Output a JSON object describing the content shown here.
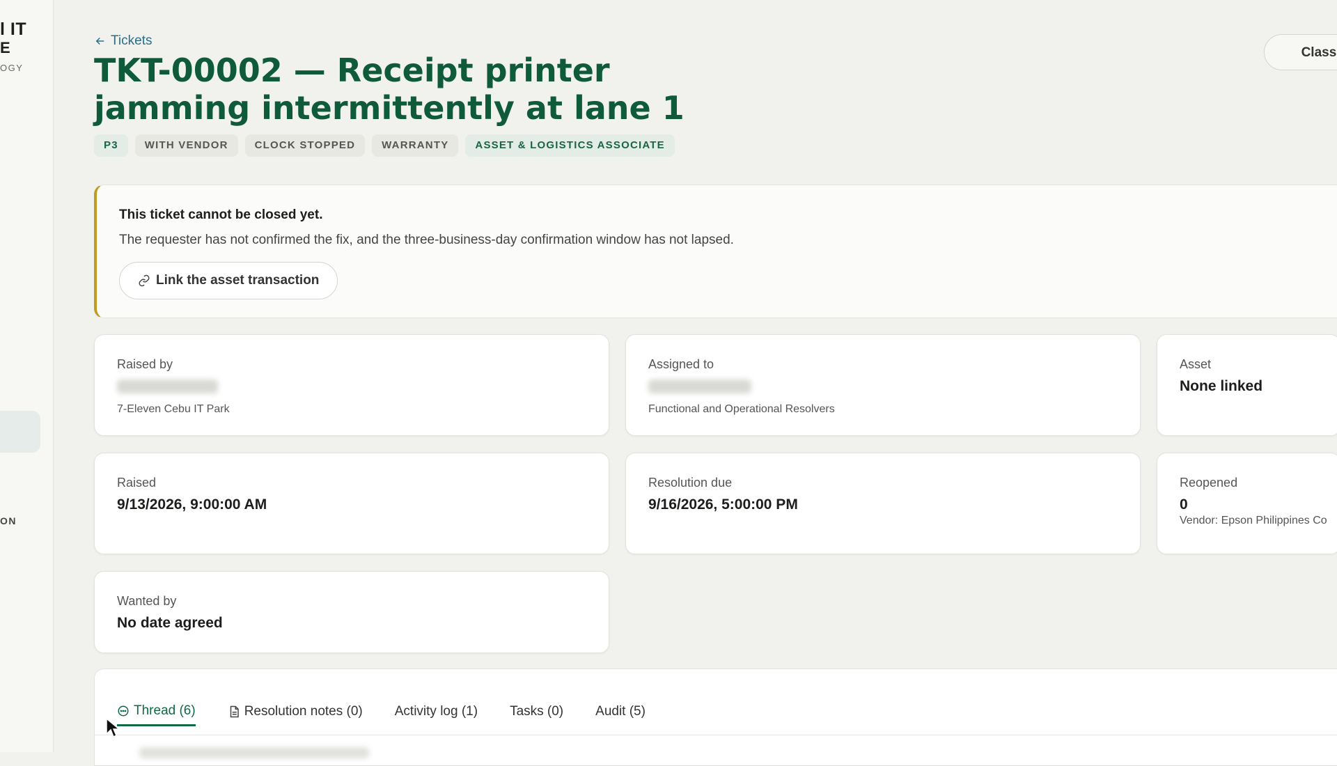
{
  "sidebar": {
    "brand_line1": "l IT",
    "brand_line2": "E",
    "brand_line3": "OGY",
    "section_label": "ON"
  },
  "header": {
    "back_label": "Tickets",
    "title": "TKT-00002 — Receipt printer jamming intermittently at lane 1",
    "classify_label": "Classify"
  },
  "tags": [
    "P3",
    "WITH VENDOR",
    "CLOCK STOPPED",
    "WARRANTY",
    "ASSET & LOGISTICS ASSOCIATE"
  ],
  "alert": {
    "title": "This ticket cannot be closed yet.",
    "body": "The requester has not confirmed the fix, and the three-business-day confirmation window has not lapsed.",
    "action_label": "Link the asset transaction",
    "accent_color": "#c19a20"
  },
  "details": {
    "raised_by": {
      "label": "Raised by",
      "sub": "7-Eleven Cebu IT Park"
    },
    "assigned_to": {
      "label": "Assigned to",
      "sub": "Functional and Operational Resolvers"
    },
    "asset": {
      "label": "Asset",
      "value": "None linked"
    },
    "raised": {
      "label": "Raised",
      "value": "9/13/2026, 9:00:00 AM"
    },
    "resolution_due": {
      "label": "Resolution due",
      "value": "9/16/2026, 5:00:00 PM"
    },
    "reopened": {
      "label": "Reopened",
      "value": "0",
      "sub": "Vendor: Epson Philippines Co"
    },
    "wanted_by": {
      "label": "Wanted by",
      "value": "No date agreed"
    }
  },
  "tabs": [
    {
      "label": "Thread (6)",
      "icon": "chat-bubble-icon",
      "active": true
    },
    {
      "label": "Resolution notes (0)",
      "icon": "document-icon",
      "active": false
    },
    {
      "label": "Activity log (1)",
      "active": false
    },
    {
      "label": "Tasks (0)",
      "active": false
    },
    {
      "label": "Audit (5)",
      "active": false
    }
  ],
  "colors": {
    "title_green": "#0f5a39",
    "active_tab": "#0f6a45",
    "link_blue": "#2c6e8a"
  }
}
